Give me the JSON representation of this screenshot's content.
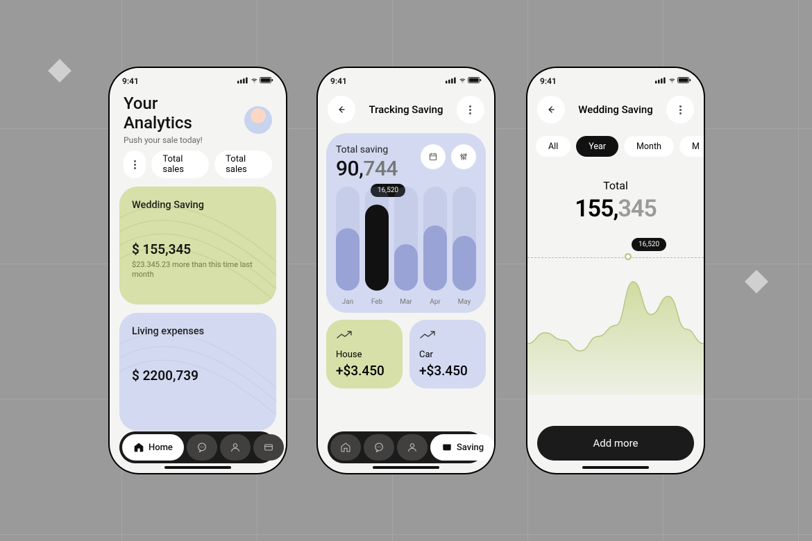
{
  "status_bar": {
    "time": "9:41"
  },
  "phone1": {
    "title_line1": "Your",
    "title_line2": "Analytics",
    "subtitle": "Push your sale today!",
    "chips": [
      "Total sales",
      "Total sales"
    ],
    "cards": [
      {
        "name": "Wedding Saving",
        "amount": "$ 155,345",
        "note": "$23.345.23 more than this time last month"
      },
      {
        "name": "Living expenses",
        "amount": "$ 2200,739"
      }
    ],
    "nav_active_label": "Home"
  },
  "phone2": {
    "title": "Tracking Saving",
    "total_label": "Total saving",
    "total_value_main": "90,",
    "total_value_muted": "744",
    "bubble": "16,520",
    "tiles": [
      {
        "name": "House",
        "amount": "+$3.450"
      },
      {
        "name": "Car",
        "amount": "+$3.450"
      }
    ],
    "nav_active_label": "Saving"
  },
  "phone3": {
    "title": "Wedding Saving",
    "segments": [
      "All",
      "Year",
      "Month",
      "M"
    ],
    "segment_active": 1,
    "total_label": "Total",
    "total_value_main": "155,",
    "total_value_muted": "345",
    "bubble": "16,520",
    "cta": "Add more"
  },
  "chart_data": [
    {
      "type": "bar",
      "title": "Total saving",
      "categories": [
        "Jan",
        "Feb",
        "Mar",
        "Apr",
        "May"
      ],
      "values": [
        12000,
        16520,
        9000,
        12500,
        10500
      ],
      "highlight_index": 1,
      "highlight_label": "16,520",
      "ylim": [
        0,
        20000
      ]
    },
    {
      "type": "area",
      "title": "Wedding Saving",
      "x": [
        0,
        1,
        2,
        3,
        4,
        5,
        6,
        7,
        8,
        9,
        10
      ],
      "values": [
        7000,
        8500,
        7500,
        6000,
        8000,
        9500,
        15500,
        11000,
        13500,
        9000,
        7000
      ],
      "marker": {
        "x": 6,
        "value": 16520,
        "label": "16,520"
      },
      "ylim": [
        0,
        20000
      ]
    }
  ]
}
